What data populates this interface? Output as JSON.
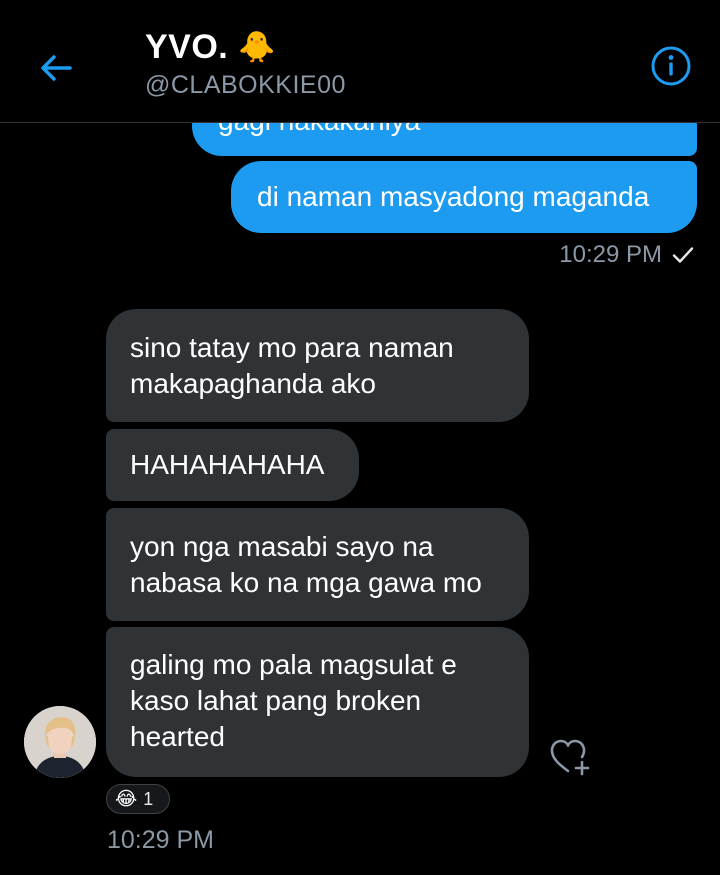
{
  "header": {
    "title": "YVO.",
    "title_emoji": "🐥",
    "handle": "@CLABOKKIE00",
    "back_icon": "arrow-left-icon",
    "info_icon": "info-icon",
    "accent_color": "#1d9bf0"
  },
  "messages": {
    "sent": [
      {
        "text": "gagi nakakahiya"
      },
      {
        "text": "di naman masyadong maganda"
      }
    ],
    "sent_timestamp": "10:29 PM",
    "sent_status_icon": "checkmark-icon",
    "received": [
      {
        "text": "sino tatay mo para naman makapaghanda ako"
      },
      {
        "text": "HAHAHAHAHA"
      },
      {
        "text": "yon nga masabi sayo na nabasa ko na mga gawa mo"
      },
      {
        "text": "galing mo pala magsulat e kaso lahat pang broken hearted"
      }
    ],
    "received_timestamp": "10:29 PM",
    "reaction": {
      "emoji": "😂",
      "count": "1"
    },
    "like_icon": "heart-add-icon",
    "avatar_icon": "user-avatar"
  }
}
